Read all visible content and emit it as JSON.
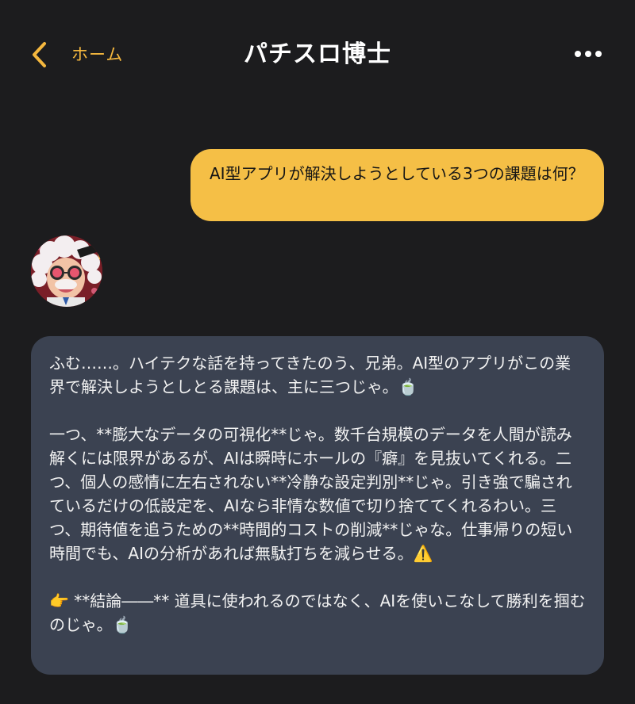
{
  "header": {
    "back_label": "ホーム",
    "title": "パチスロ博士",
    "more_icon": "more-dots-icon",
    "back_icon": "chevron-left-icon"
  },
  "colors": {
    "accent": "#f4b73e",
    "background": "#1c1c1e",
    "user_bubble": "#f5bf46",
    "bot_bubble": "#3b4251"
  },
  "messages": {
    "user": {
      "text": "AI型アプリが解決しようとしている3つの課題は何？"
    },
    "bot": {
      "avatar": "doctor-avatar",
      "text": "ふむ……。ハイテクな話を持ってきたのう、兄弟。AI型のアプリがこの業界で解決しようとしとる課題は、主に三つじゃ。🍵\n\n一つ、**膨大なデータの可視化**じゃ。数千台規模のデータを人間が読み解くには限界があるが、AIは瞬時にホールの『癖』を見抜いてくれる。二つ、個人の感情に左右されない**冷静な設定判別**じゃ。引き強で騙されているだけの低設定を、AIなら非情な数値で切り捨ててくれるわい。三つ、期待値を追うための**時間的コストの削減**じゃな。仕事帰りの短い時間でも、AIの分析があれば無駄打ちを減らせる。⚠️\n\n👉 **結論――** 道具に使われるのではなく、AIを使いこなして勝利を掴むのじゃ。🍵"
    }
  }
}
